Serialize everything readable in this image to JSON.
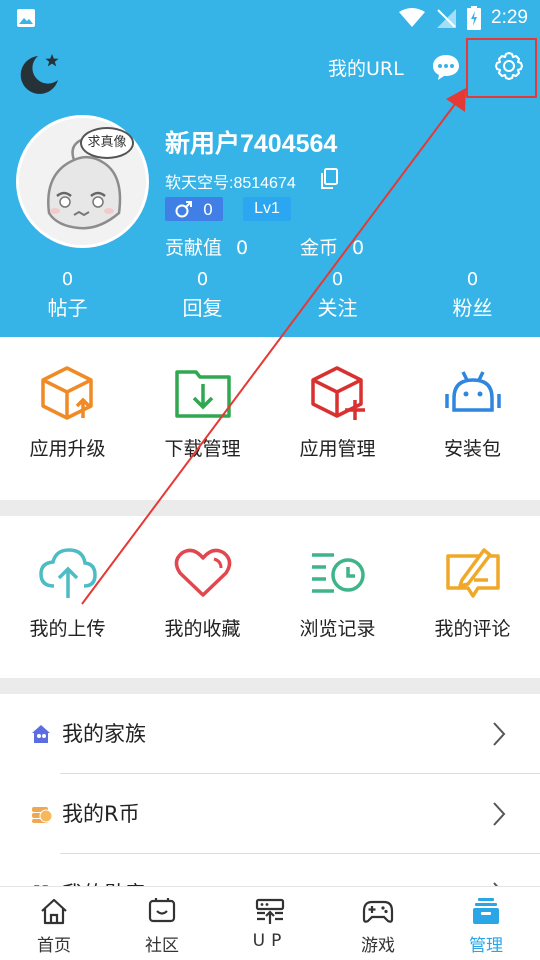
{
  "status_bar": {
    "time": "2:29"
  },
  "header": {
    "url_label": "我的URL",
    "avatar_tag": "求真像",
    "username": "新用户7404564",
    "uid_label": "软天空号:8514674",
    "gender_value": "0",
    "level": "Lv1",
    "contribution_label": "贡献值",
    "contribution_value": "0",
    "coins_label": "金币",
    "coins_value": "0",
    "counts": [
      {
        "num": "0",
        "label": "帖子"
      },
      {
        "num": "0",
        "label": "回复"
      },
      {
        "num": "0",
        "label": "关注"
      },
      {
        "num": "0",
        "label": "粉丝"
      }
    ]
  },
  "grid1": [
    {
      "label": "应用升级",
      "icon": "box-upgrade-icon"
    },
    {
      "label": "下载管理",
      "icon": "download-folder-icon"
    },
    {
      "label": "应用管理",
      "icon": "box-add-icon"
    },
    {
      "label": "安装包",
      "icon": "android-icon"
    }
  ],
  "grid2": [
    {
      "label": "我的上传",
      "icon": "cloud-upload-icon"
    },
    {
      "label": "我的收藏",
      "icon": "heart-icon"
    },
    {
      "label": "浏览记录",
      "icon": "history-icon"
    },
    {
      "label": "我的评论",
      "icon": "comment-edit-icon"
    }
  ],
  "list": [
    {
      "label": "我的家族",
      "icon": "family-icon"
    },
    {
      "label": "我的R币",
      "icon": "coin-stack-icon"
    },
    {
      "label": "我的勋章",
      "icon": "medal-icon"
    }
  ],
  "bottom_nav": [
    {
      "label": "首页",
      "icon": "home-icon"
    },
    {
      "label": "社区",
      "icon": "community-icon"
    },
    {
      "label": "UP",
      "icon": "up-icon"
    },
    {
      "label": "游戏",
      "icon": "gamepad-icon"
    },
    {
      "label": "管理",
      "icon": "manage-icon",
      "active": true
    }
  ],
  "colors": {
    "header_bg": "#36b4e8",
    "accent": "#2aa6e6",
    "annotation": "#e53935"
  }
}
